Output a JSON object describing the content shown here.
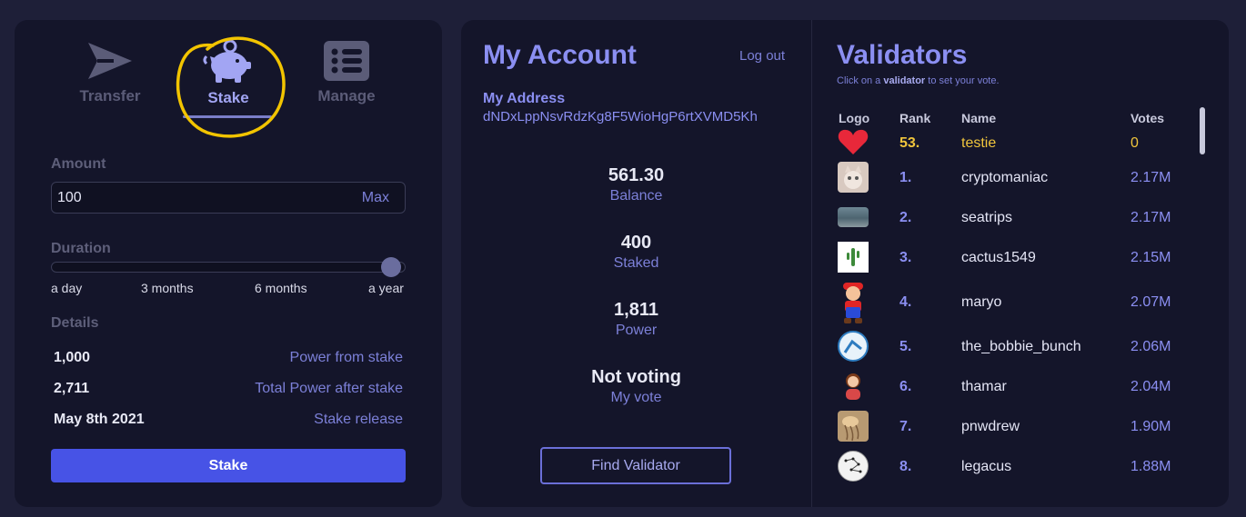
{
  "tabs": [
    {
      "label": "Transfer",
      "icon": "send-icon"
    },
    {
      "label": "Stake",
      "icon": "piggy-bank-icon",
      "active": true
    },
    {
      "label": "Manage",
      "icon": "list-icon"
    }
  ],
  "stake_form": {
    "amount_label": "Amount",
    "amount_value": "100",
    "max_label": "Max",
    "duration_label": "Duration",
    "duration_ticks": [
      "a day",
      "3 months",
      "6 months",
      "a year"
    ],
    "duration_selected": "a year",
    "details_label": "Details",
    "details": [
      {
        "value": "1,000",
        "label": "Power from stake"
      },
      {
        "value": "2,711",
        "label": "Total Power after stake"
      },
      {
        "value": "May 8th 2021",
        "label": "Stake release"
      }
    ],
    "stake_button": "Stake"
  },
  "account": {
    "title": "My Account",
    "logout": "Log out",
    "address_label": "My Address",
    "address": "dNDxLppNsvRdzKg8F5WioHgP6rtXVMD5Kh",
    "stats": [
      {
        "value": "561.30",
        "label": "Balance"
      },
      {
        "value": "400",
        "label": "Staked"
      },
      {
        "value": "1,811",
        "label": "Power"
      },
      {
        "value": "Not voting",
        "label": "My vote"
      }
    ],
    "find_button": "Find Validator"
  },
  "validators": {
    "title": "Validators",
    "subtitle_pre": "Click on a ",
    "subtitle_bold": "validator",
    "subtitle_post": " to set your vote.",
    "columns": [
      "Logo",
      "Rank",
      "Name",
      "Votes"
    ],
    "rows": [
      {
        "rank": "53.",
        "name": "testie",
        "votes": "0",
        "logo": "heart-icon",
        "self": true
      },
      {
        "rank": "1.",
        "name": "cryptomaniac",
        "votes": "2.17M",
        "logo": "cat-avatar"
      },
      {
        "rank": "2.",
        "name": "seatrips",
        "votes": "2.17M",
        "logo": "sea-avatar"
      },
      {
        "rank": "3.",
        "name": "cactus1549",
        "votes": "2.15M",
        "logo": "cactus-avatar"
      },
      {
        "rank": "4.",
        "name": "maryo",
        "votes": "2.07M",
        "logo": "mario-avatar"
      },
      {
        "rank": "5.",
        "name": "the_bobbie_bunch",
        "votes": "2.06M",
        "logo": "blue-logo-avatar"
      },
      {
        "rank": "6.",
        "name": "thamar",
        "votes": "2.04M",
        "logo": "woman-avatar"
      },
      {
        "rank": "7.",
        "name": "pnwdrew",
        "votes": "1.90M",
        "logo": "jellyfish-avatar"
      },
      {
        "rank": "8.",
        "name": "legacus",
        "votes": "1.88M",
        "logo": "constellation-avatar"
      }
    ]
  },
  "colors": {
    "background": "#1e1f38",
    "panel": "#14152a",
    "accent": "#8b8ff2",
    "button": "#4753e6",
    "highlight": "#f0c53c"
  }
}
